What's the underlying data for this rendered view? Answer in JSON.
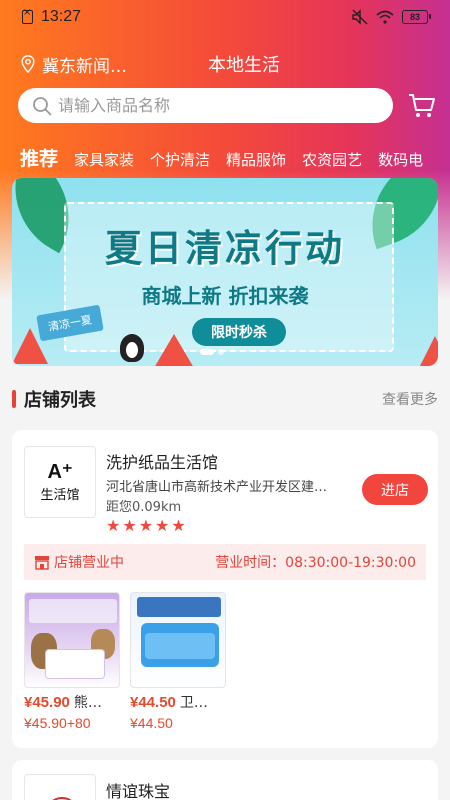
{
  "status_bar": {
    "time": "13:27",
    "battery": "83",
    "icons": [
      "sim-off-icon",
      "mute-icon",
      "wifi-icon",
      "battery-icon"
    ]
  },
  "header": {
    "location": "冀东新闻…",
    "local_life": "本地生活",
    "search_placeholder": "请输入商品名称",
    "gradient_colors": [
      "#ff7a1e",
      "#f44a3a",
      "#e53459",
      "#c53092"
    ]
  },
  "categories": [
    {
      "label": "推荐",
      "active": true
    },
    {
      "label": "家具家装",
      "active": false
    },
    {
      "label": "个护清洁",
      "active": false
    },
    {
      "label": "精品服饰",
      "active": false
    },
    {
      "label": "农资园艺",
      "active": false
    },
    {
      "label": "数码电",
      "active": false
    }
  ],
  "banner": {
    "title": "夏日清凉行动",
    "subtitle": "商城上新 折扣来袭",
    "button": "限时秒杀",
    "sign": "清凉一夏",
    "dots": 2,
    "active_dot": 0
  },
  "store_section": {
    "title": "店铺列表",
    "more": "查看更多"
  },
  "stores": [
    {
      "logo_mark": "A⁺",
      "logo_text": "生活馆",
      "name": "洗护纸品生活馆",
      "address": "河北省唐山市高新技术产业开发区建…",
      "distance": "距您0.09km",
      "rating": 5,
      "enter_label": "进店",
      "open_status": "店铺营业中",
      "hours": "营业时间：08:30:00-19:30:00",
      "products": [
        {
          "price": "¥45.90",
          "name": "熊…",
          "sub_price": "¥45.90+80"
        },
        {
          "price": "¥44.50",
          "name": "卫…",
          "sub_price": "¥44.50"
        }
      ]
    },
    {
      "name": "情谊珠宝"
    }
  ],
  "colors": {
    "accent": "#f1453e",
    "price": "#e54a2b",
    "open_bar_bg": "#fcecec"
  }
}
